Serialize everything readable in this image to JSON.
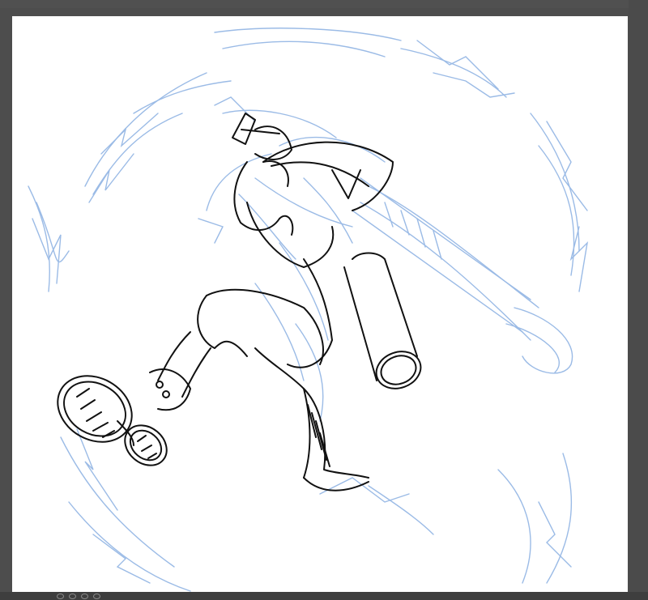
{
  "app": {
    "title": ""
  },
  "canvas": {
    "paper_color": "#ffffff",
    "rough_sketch_color": "#9bbbe6",
    "line_art_color": "#111111",
    "workspace_color": "#4d4d4d"
  },
  "icons": {
    "status_buttons": [
      "zoom-out-icon",
      "zoom-reset-icon",
      "zoom-in-icon",
      "rotate-icon"
    ]
  }
}
